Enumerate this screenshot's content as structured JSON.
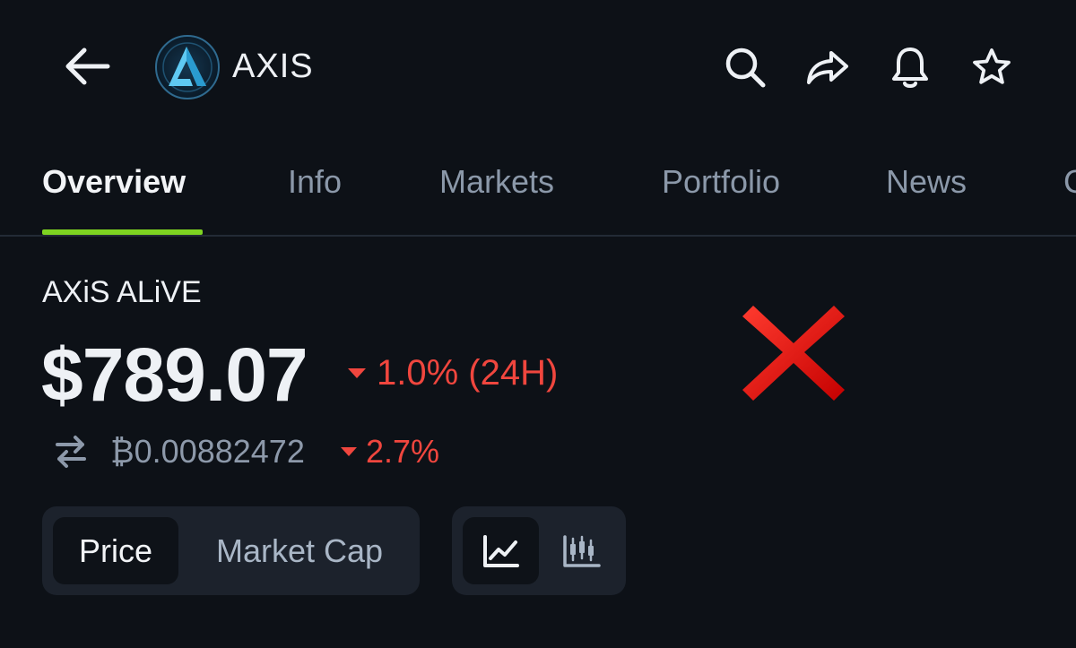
{
  "header": {
    "app_name": "AXIS",
    "icons": [
      "back-arrow-icon",
      "axis-logo",
      "search-icon",
      "share-icon",
      "bell-icon",
      "star-icon"
    ]
  },
  "tabs": [
    {
      "label": "Overview",
      "active": true
    },
    {
      "label": "Info",
      "active": false
    },
    {
      "label": "Markets",
      "active": false
    },
    {
      "label": "Portfolio",
      "active": false
    },
    {
      "label": "News",
      "active": false
    },
    {
      "label": "C",
      "active": false
    }
  ],
  "coin": {
    "name": "AXiS ALiVE",
    "price": "$789.07",
    "change_24h": "1.0% (24H)",
    "btc_price": "₿0.00882472",
    "btc_change": "2.7%",
    "change_direction": "down"
  },
  "toggles": {
    "price_label": "Price",
    "market_cap_label": "Market Cap",
    "selected_metric": "Price",
    "chart_types": [
      "line-chart-icon",
      "candlestick-chart-icon"
    ],
    "selected_chart": "line-chart-icon"
  },
  "colors": {
    "background": "#0d1117",
    "accent_green": "#7ed321",
    "negative_red": "#f0463e",
    "overlay_red_x": "#e0100f"
  }
}
